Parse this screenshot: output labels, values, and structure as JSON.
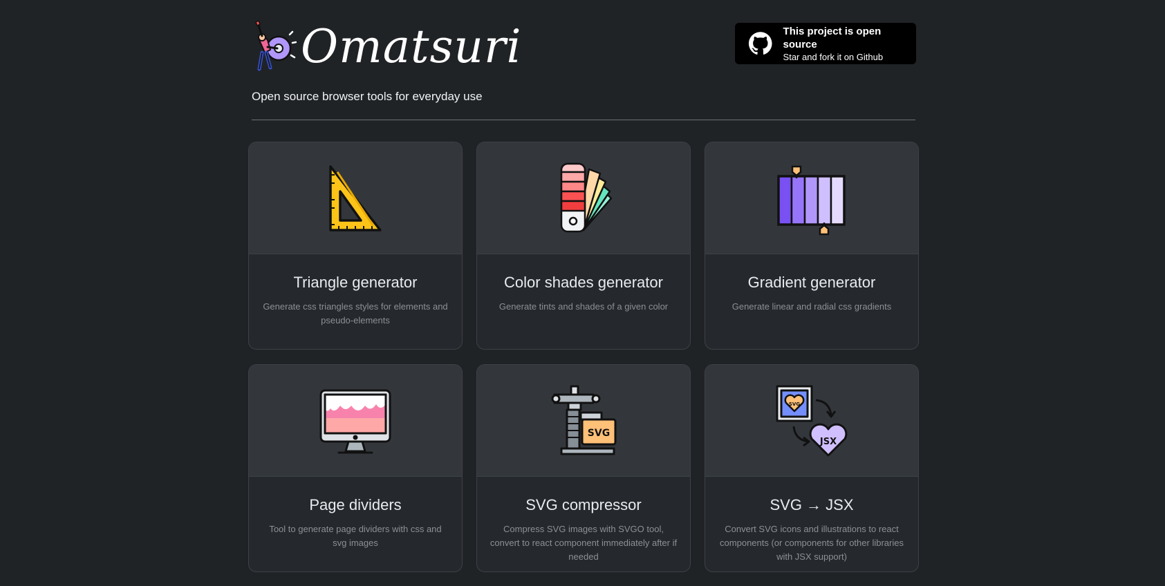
{
  "brand": {
    "name": "Omatsuri"
  },
  "github": {
    "title": "This project is open source",
    "subtitle": "Star and fork it on Github"
  },
  "tagline": "Open source browser tools for everyday use",
  "tools": [
    {
      "title": "Triangle generator",
      "description": "Generate css triangles styles for elements and pseudo-elements",
      "icon": "set-square-icon"
    },
    {
      "title": "Color shades generator",
      "description": "Generate tints and shades of a given color",
      "icon": "color-palette-icon"
    },
    {
      "title": "Gradient generator",
      "description": "Generate linear and radial css gradients",
      "icon": "gradient-icon"
    },
    {
      "title": "Page dividers",
      "description": "Tool to generate page dividers with css and svg images",
      "icon": "monitor-icon"
    },
    {
      "title": "SVG compressor",
      "description": "Compress SVG images with SVGO tool, convert to react component immediately after if needed",
      "icon": "clamp-icon"
    },
    {
      "title": "SVG → JSX",
      "description": "Convert SVG icons and illustrations to react components (or components for other libraries with JSX support)",
      "icon": "svg-to-jsx-icon"
    }
  ],
  "colors": {
    "background": "#202326",
    "card": "#25282c",
    "card_image": "#33373c"
  }
}
